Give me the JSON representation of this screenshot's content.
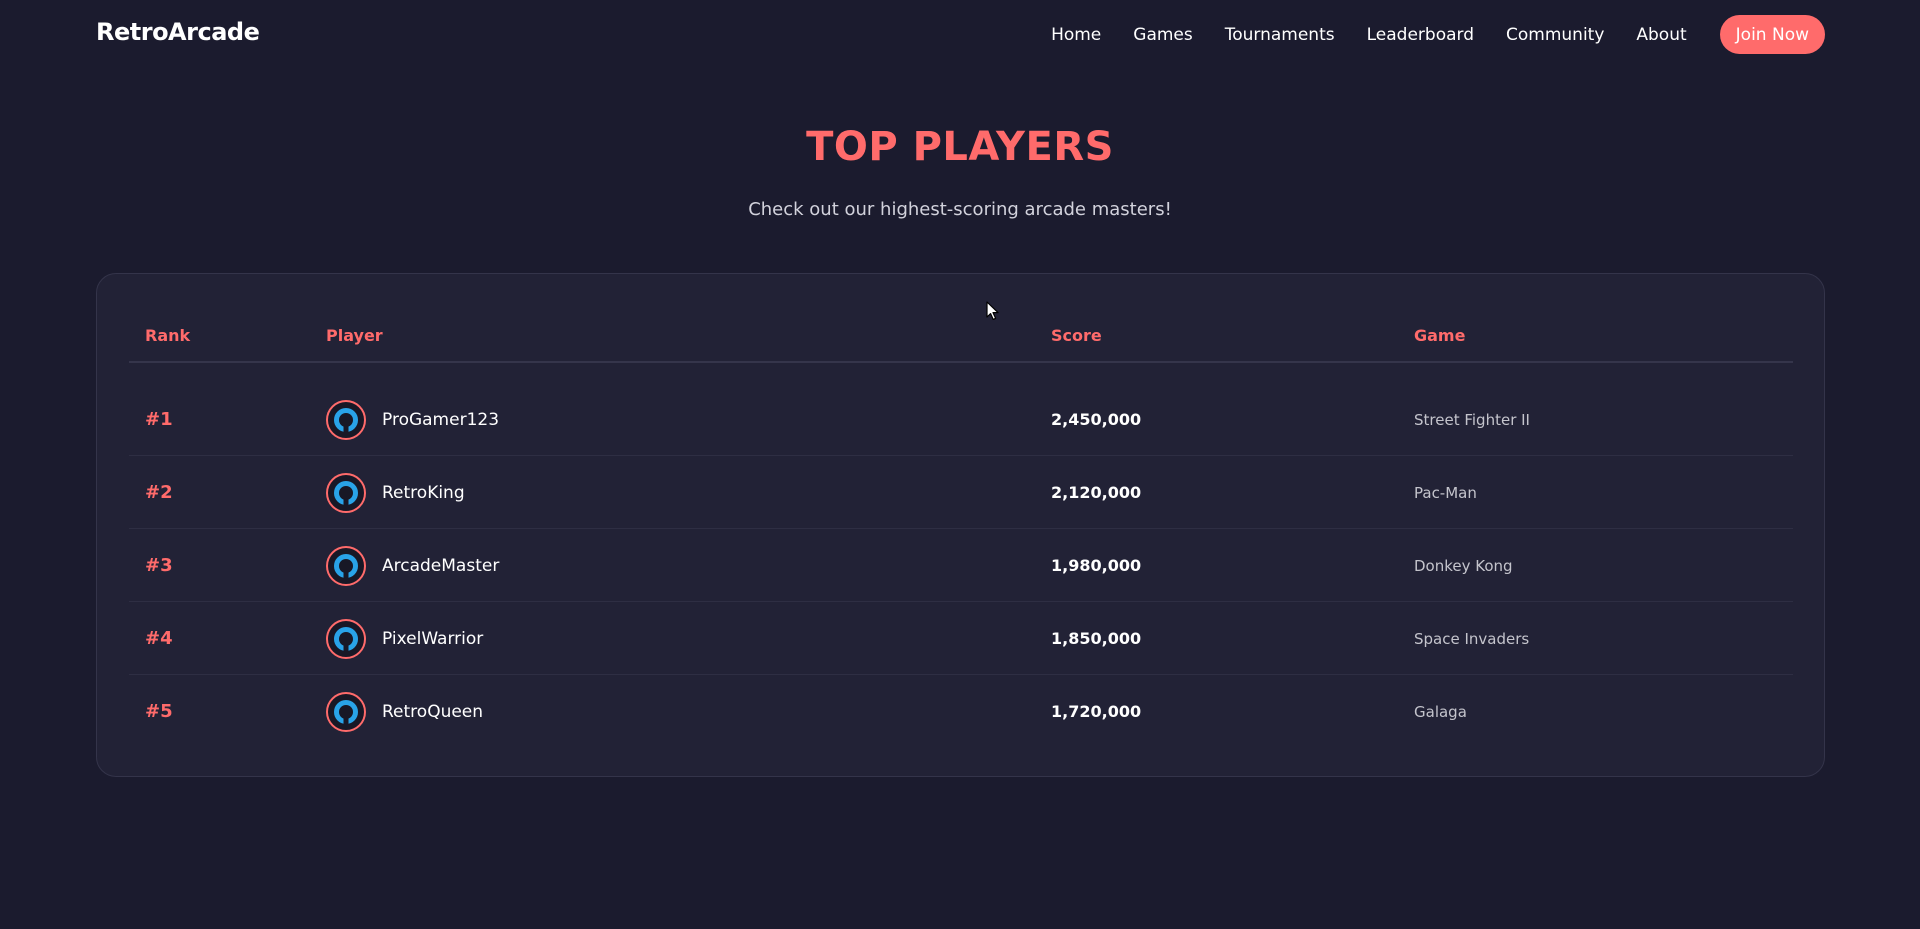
{
  "nav": {
    "logo": "RetroArcade",
    "links": [
      "Home",
      "Games",
      "Tournaments",
      "Leaderboard",
      "Community",
      "About"
    ],
    "cta_label": "Join Now"
  },
  "hero": {
    "title": "TOP PLAYERS",
    "subtitle": "Check out our highest-scoring arcade masters!"
  },
  "leaderboard": {
    "columns": [
      "Rank",
      "Player",
      "Score",
      "Game"
    ],
    "rows": [
      {
        "rank": "#1",
        "player": "ProGamer123",
        "score": "2,450,000",
        "game": "Street Fighter II"
      },
      {
        "rank": "#2",
        "player": "RetroKing",
        "score": "2,120,000",
        "game": "Pac-Man"
      },
      {
        "rank": "#3",
        "player": "ArcadeMaster",
        "score": "1,980,000",
        "game": "Donkey Kong"
      },
      {
        "rank": "#4",
        "player": "PixelWarrior",
        "score": "1,850,000",
        "game": "Space Invaders"
      },
      {
        "rank": "#5",
        "player": "RetroQueen",
        "score": "1,720,000",
        "game": "Galaga"
      }
    ]
  },
  "icons": {
    "avatar": "user-avatar-icon",
    "cursor": "mouse-pointer-icon"
  },
  "colors": {
    "background": "#1b1b2e",
    "card": "#222236",
    "accent": "#ff6b6b",
    "avatar_icon": "#29a3e8"
  }
}
